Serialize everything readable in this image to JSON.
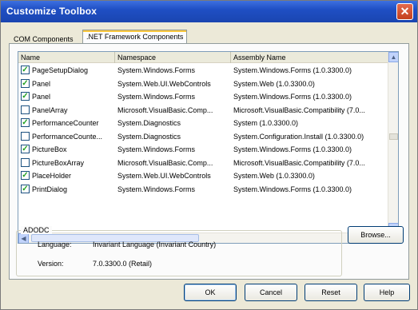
{
  "window": {
    "title": "Customize Toolbox",
    "close_glyph": "✕"
  },
  "tabs": [
    {
      "label": "COM Components"
    },
    {
      "label": ".NET Framework Components",
      "active": true
    }
  ],
  "list": {
    "columns": [
      "Name",
      "Namespace",
      "Assembly Name"
    ],
    "rows": [
      {
        "checked": true,
        "name": "PageSetupDialog",
        "namespace": "System.Windows.Forms",
        "assembly": "System.Windows.Forms (1.0.3300.0)"
      },
      {
        "checked": true,
        "name": "Panel",
        "namespace": "System.Web.UI.WebControls",
        "assembly": "System.Web (1.0.3300.0)"
      },
      {
        "checked": true,
        "name": "Panel",
        "namespace": "System.Windows.Forms",
        "assembly": "System.Windows.Forms (1.0.3300.0)"
      },
      {
        "checked": false,
        "name": "PanelArray",
        "namespace": "Microsoft.VisualBasic.Comp...",
        "assembly": "Microsoft.VisualBasic.Compatibility (7.0..."
      },
      {
        "checked": true,
        "name": "PerformanceCounter",
        "namespace": "System.Diagnostics",
        "assembly": "System (1.0.3300.0)"
      },
      {
        "checked": false,
        "name": "PerformanceCounte...",
        "namespace": "System.Diagnostics",
        "assembly": "System.Configuration.Install (1.0.3300.0)"
      },
      {
        "checked": true,
        "name": "PictureBox",
        "namespace": "System.Windows.Forms",
        "assembly": "System.Windows.Forms (1.0.3300.0)"
      },
      {
        "checked": false,
        "name": "PictureBoxArray",
        "namespace": "Microsoft.VisualBasic.Comp...",
        "assembly": "Microsoft.VisualBasic.Compatibility (7.0..."
      },
      {
        "checked": true,
        "name": "PlaceHolder",
        "namespace": "System.Web.UI.WebControls",
        "assembly": "System.Web (1.0.3300.0)"
      },
      {
        "checked": true,
        "name": "PrintDialog",
        "namespace": "System.Windows.Forms",
        "assembly": "System.Windows.Forms (1.0.3300.0)"
      }
    ]
  },
  "details": {
    "group_title": "ADODC",
    "language_label": "Language:",
    "language_value": "Invariant Language (Invariant Country)",
    "version_label": "Version:",
    "version_value": "7.0.3300.0 (Retail)"
  },
  "buttons": {
    "browse": "Browse...",
    "ok": "OK",
    "cancel": "Cancel",
    "reset": "Reset",
    "help": "Help"
  },
  "scrollbar_glyphs": {
    "up": "▲",
    "down": "▼",
    "left": "◀",
    "right": "▶"
  }
}
